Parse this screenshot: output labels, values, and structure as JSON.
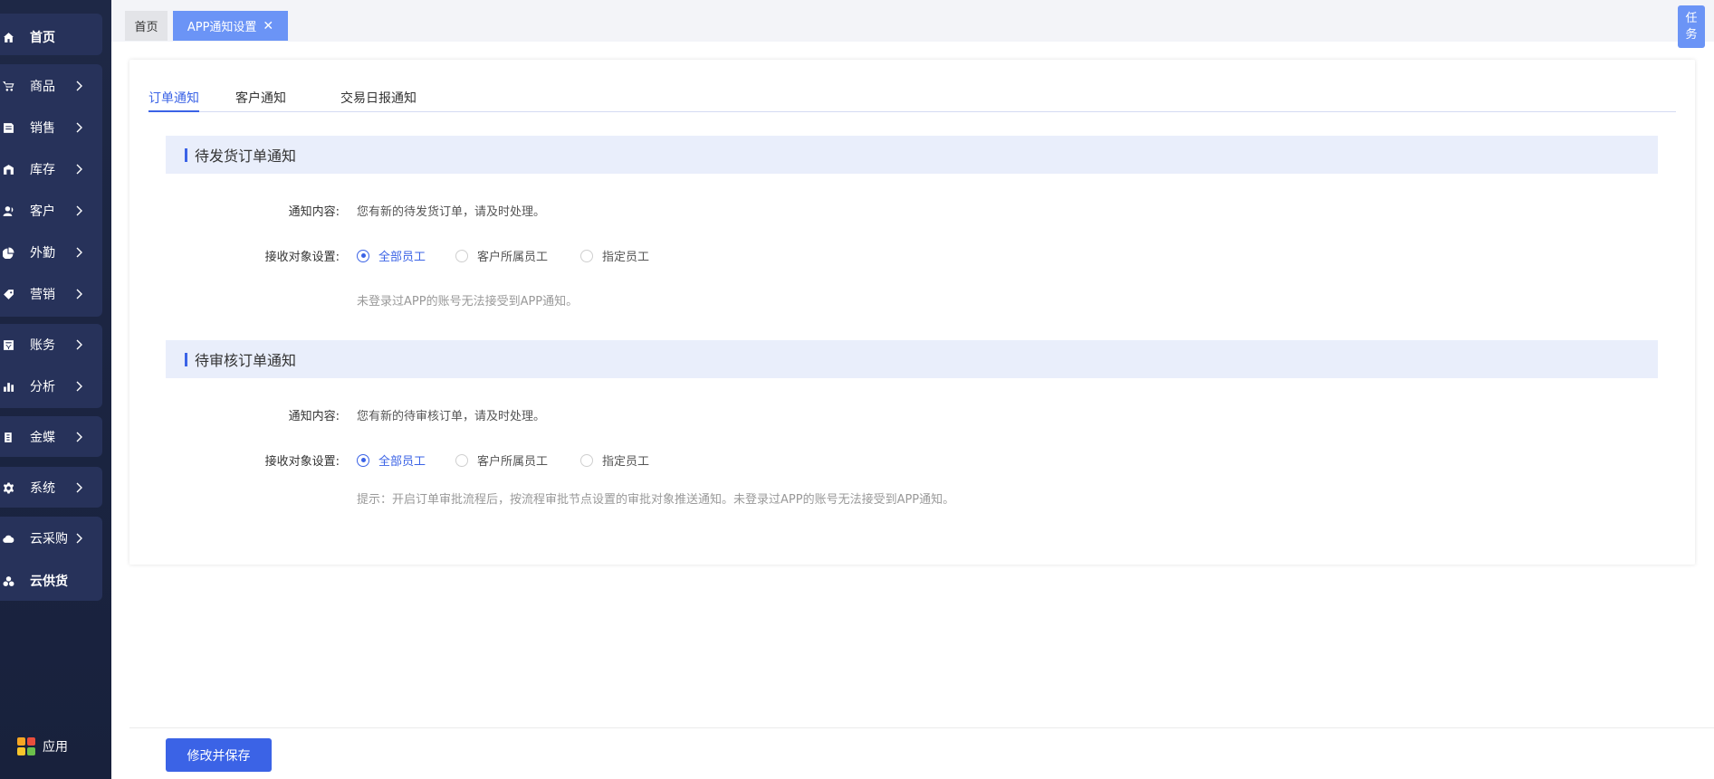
{
  "sidebar": {
    "items": [
      {
        "label": "首页",
        "icon": "home-icon",
        "chevron": false
      },
      {
        "label": "商品",
        "icon": "cart-icon",
        "chevron": true
      },
      {
        "label": "销售",
        "icon": "sales-icon",
        "chevron": true
      },
      {
        "label": "库存",
        "icon": "warehouse-icon",
        "chevron": true
      },
      {
        "label": "客户",
        "icon": "customer-icon",
        "chevron": true
      },
      {
        "label": "外勤",
        "icon": "fieldwork-icon",
        "chevron": true
      },
      {
        "label": "营销",
        "icon": "tag-icon",
        "chevron": true
      },
      {
        "label": "账务",
        "icon": "ledger-icon",
        "chevron": true
      },
      {
        "label": "分析",
        "icon": "chart-icon",
        "chevron": true
      },
      {
        "label": "金蝶",
        "icon": "kingdee-icon",
        "chevron": true
      },
      {
        "label": "系统",
        "icon": "gear-icon",
        "chevron": true
      },
      {
        "label": "云采购",
        "icon": "cloud-icon",
        "chevron": true
      },
      {
        "label": "云供货",
        "icon": "supply-icon",
        "chevron": false
      }
    ],
    "app_label": "应用"
  },
  "tabs": {
    "home": "首页",
    "active": "APP通知设置",
    "close": "✕"
  },
  "task_button": {
    "line1": "任",
    "line2": "务"
  },
  "subtabs": [
    "订单通知",
    "客户通知",
    "交易日报通知"
  ],
  "sections": [
    {
      "title": "待发货订单通知",
      "content_label": "通知内容:",
      "content": "您有新的待发货订单，请及时处理。",
      "receiver_label": "接收对象设置:",
      "options": [
        "全部员工",
        "客户所属员工",
        "指定员工"
      ],
      "selected": "全部员工",
      "hint": "未登录过APP的账号无法接受到APP通知。"
    },
    {
      "title": "待审核订单通知",
      "content_label": "通知内容:",
      "content": "您有新的待审核订单，请及时处理。",
      "receiver_label": "接收对象设置:",
      "options": [
        "全部员工",
        "客户所属员工",
        "指定员工"
      ],
      "selected": "全部员工",
      "hint": "提示：开启订单审批流程后，按流程审批节点设置的审批对象推送通知。未登录过APP的账号无法接受到APP通知。"
    }
  ],
  "footer": {
    "save_label": "修改并保存"
  },
  "colors": {
    "accent": "#3b63e6",
    "tab_active": "#6b94f6",
    "sidebar": "#1e2846"
  }
}
